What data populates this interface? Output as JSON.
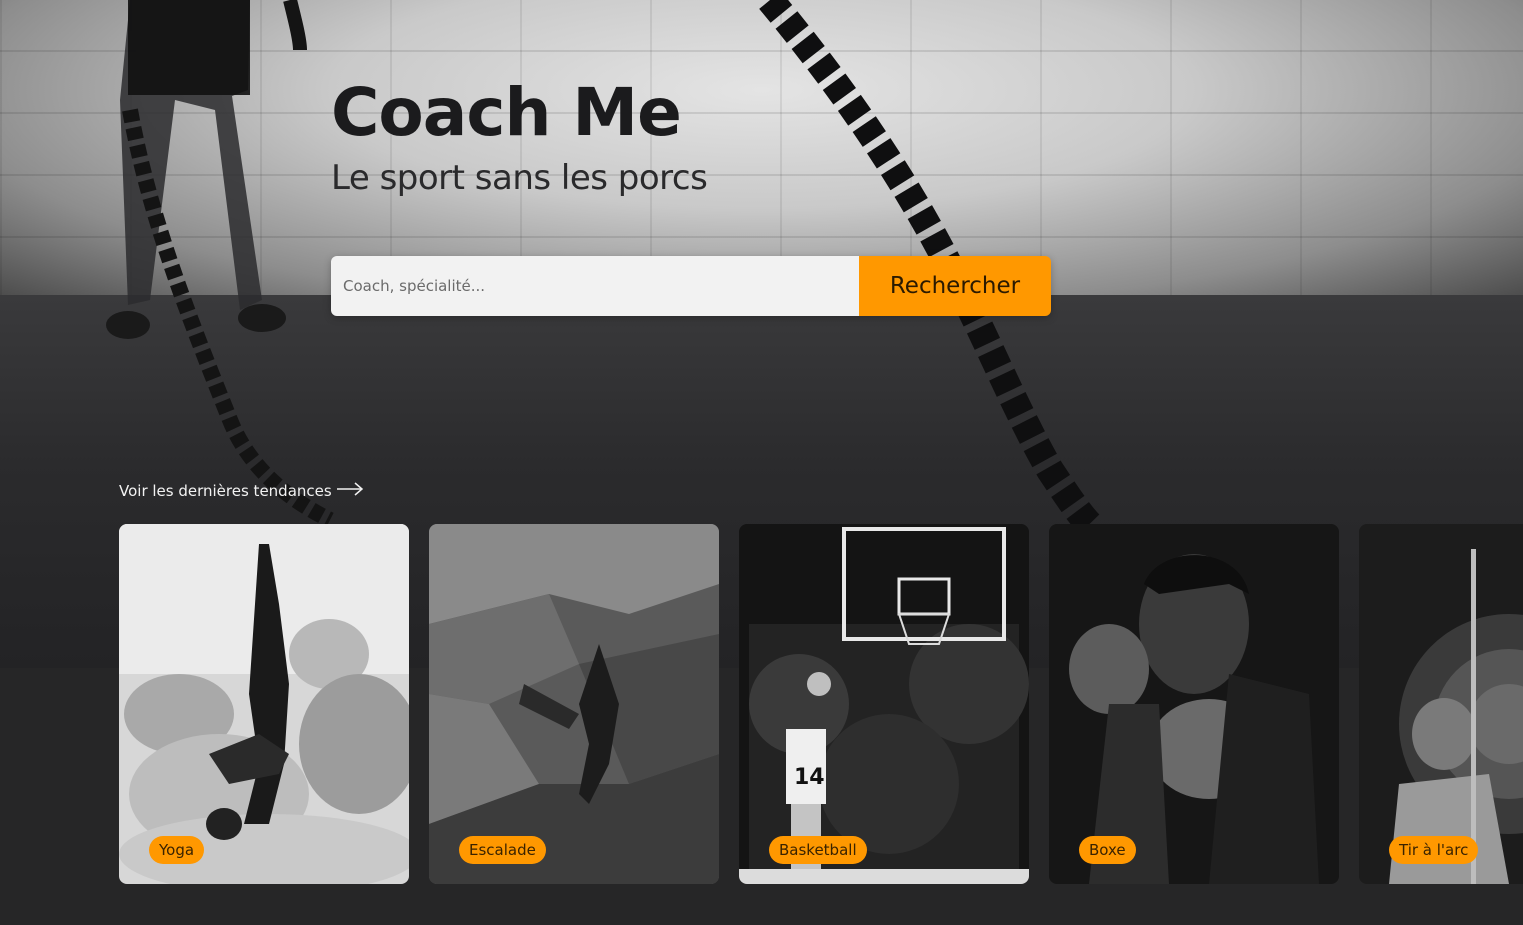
{
  "hero": {
    "title": "Coach Me",
    "subtitle": "Le sport sans les porcs"
  },
  "search": {
    "placeholder": "Coach, spécialité...",
    "value": "",
    "button_label": "Rechercher"
  },
  "trends": {
    "link_label": "Voir les dernières tendances",
    "arrow_icon": "arrow-right-icon"
  },
  "cards": [
    {
      "label": "Yoga"
    },
    {
      "label": "Escalade"
    },
    {
      "label": "Basketball"
    },
    {
      "label": "Boxe"
    },
    {
      "label": "Tir à l'arc"
    }
  ],
  "colors": {
    "accent": "#ff9800",
    "background": "#262627"
  }
}
